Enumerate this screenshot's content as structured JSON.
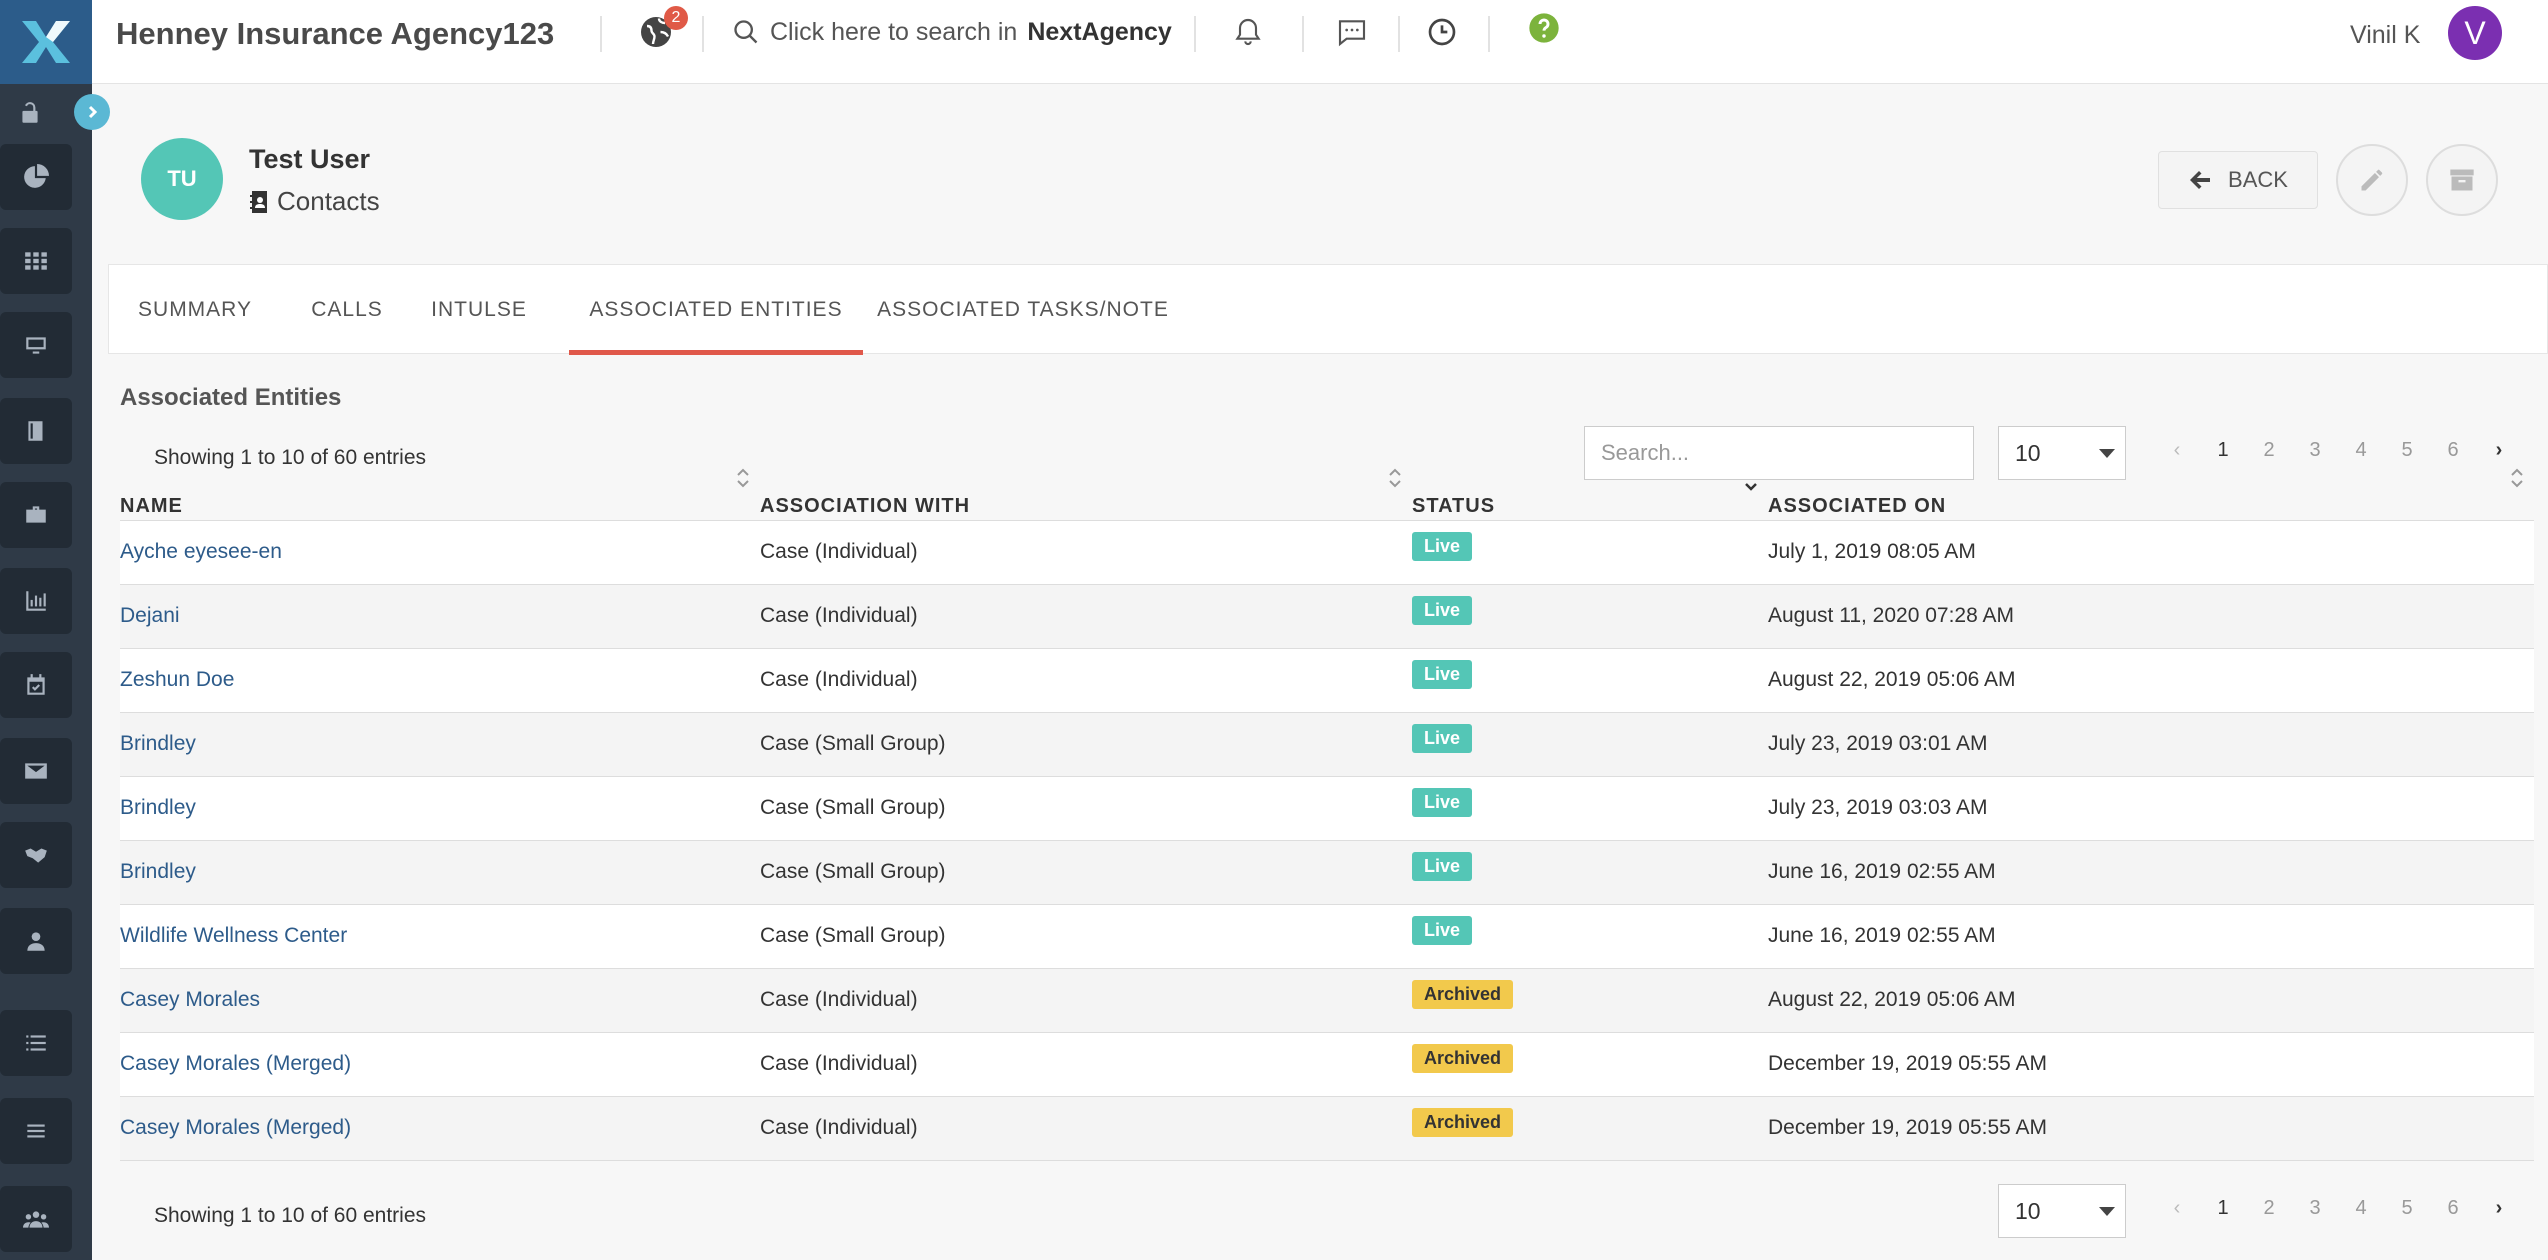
{
  "header": {
    "agency_name": "Henney Insurance Agency123",
    "notification_count": "2",
    "search_prefix": "Click here to search in",
    "search_brand": "NextAgency",
    "user_name": "Vinil K",
    "user_initial": "V"
  },
  "sidebar": {
    "items": [
      "dashboard-icon",
      "grid-icon",
      "monitor-icon",
      "book-icon",
      "briefcase-icon",
      "chart-icon",
      "calendar-check-icon",
      "mail-icon",
      "handshake-icon",
      "user-icon",
      "list-icon",
      "menu-icon",
      "users-icon"
    ]
  },
  "contact": {
    "initials": "TU",
    "name": "Test User",
    "type": "Contacts",
    "back_label": "BACK"
  },
  "tabs": [
    {
      "label": "SUMMARY",
      "active": false
    },
    {
      "label": "CALLS",
      "active": false
    },
    {
      "label": "INTULSE",
      "active": false
    },
    {
      "label": "ASSOCIATED ENTITIES",
      "active": true
    },
    {
      "label": "ASSOCIATED TASKS/NOTE",
      "active": false
    }
  ],
  "section": {
    "title": "Associated Entities",
    "entries_text": "Showing 1 to 10 of 60 entries",
    "search_placeholder": "Search...",
    "page_size": "10",
    "pages": [
      "1",
      "2",
      "3",
      "4",
      "5",
      "6"
    ],
    "current_page": "1",
    "prev": "‹",
    "next": "›"
  },
  "table": {
    "columns": [
      "NAME",
      "ASSOCIATION WITH",
      "STATUS",
      "ASSOCIATED ON"
    ],
    "rows": [
      {
        "name": "Ayche eyesee-en",
        "assoc": "Case (Individual)",
        "status": "Live",
        "date": "July 1, 2019 08:05 AM"
      },
      {
        "name": "Dejani",
        "assoc": "Case (Individual)",
        "status": "Live",
        "date": "August 11, 2020 07:28 AM"
      },
      {
        "name": "Zeshun Doe",
        "assoc": "Case (Individual)",
        "status": "Live",
        "date": "August 22, 2019 05:06 AM"
      },
      {
        "name": "Brindley",
        "assoc": "Case (Small Group)",
        "status": "Live",
        "date": "July 23, 2019 03:01 AM"
      },
      {
        "name": "Brindley",
        "assoc": "Case (Small Group)",
        "status": "Live",
        "date": "July 23, 2019 03:03 AM"
      },
      {
        "name": "Brindley",
        "assoc": "Case (Small Group)",
        "status": "Live",
        "date": "June 16, 2019 02:55 AM"
      },
      {
        "name": "Wildlife Wellness Center",
        "assoc": "Case (Small Group)",
        "status": "Live",
        "date": "June 16, 2019 02:55 AM"
      },
      {
        "name": "Casey Morales",
        "assoc": "Case (Individual)",
        "status": "Archived",
        "date": "August 22, 2019 05:06 AM"
      },
      {
        "name": "Casey Morales (Merged)",
        "assoc": "Case (Individual)",
        "status": "Archived",
        "date": "December 19, 2019 05:55 AM"
      },
      {
        "name": "Casey Morales (Merged)",
        "assoc": "Case (Individual)",
        "status": "Archived",
        "date": "December 19, 2019 05:55 AM"
      }
    ]
  },
  "colors": {
    "accent_tab": "#e0584a",
    "live": "#54c6b6",
    "archived": "#f2c94c",
    "avatar": "#7b2fb1",
    "link": "#2d5b8a"
  }
}
